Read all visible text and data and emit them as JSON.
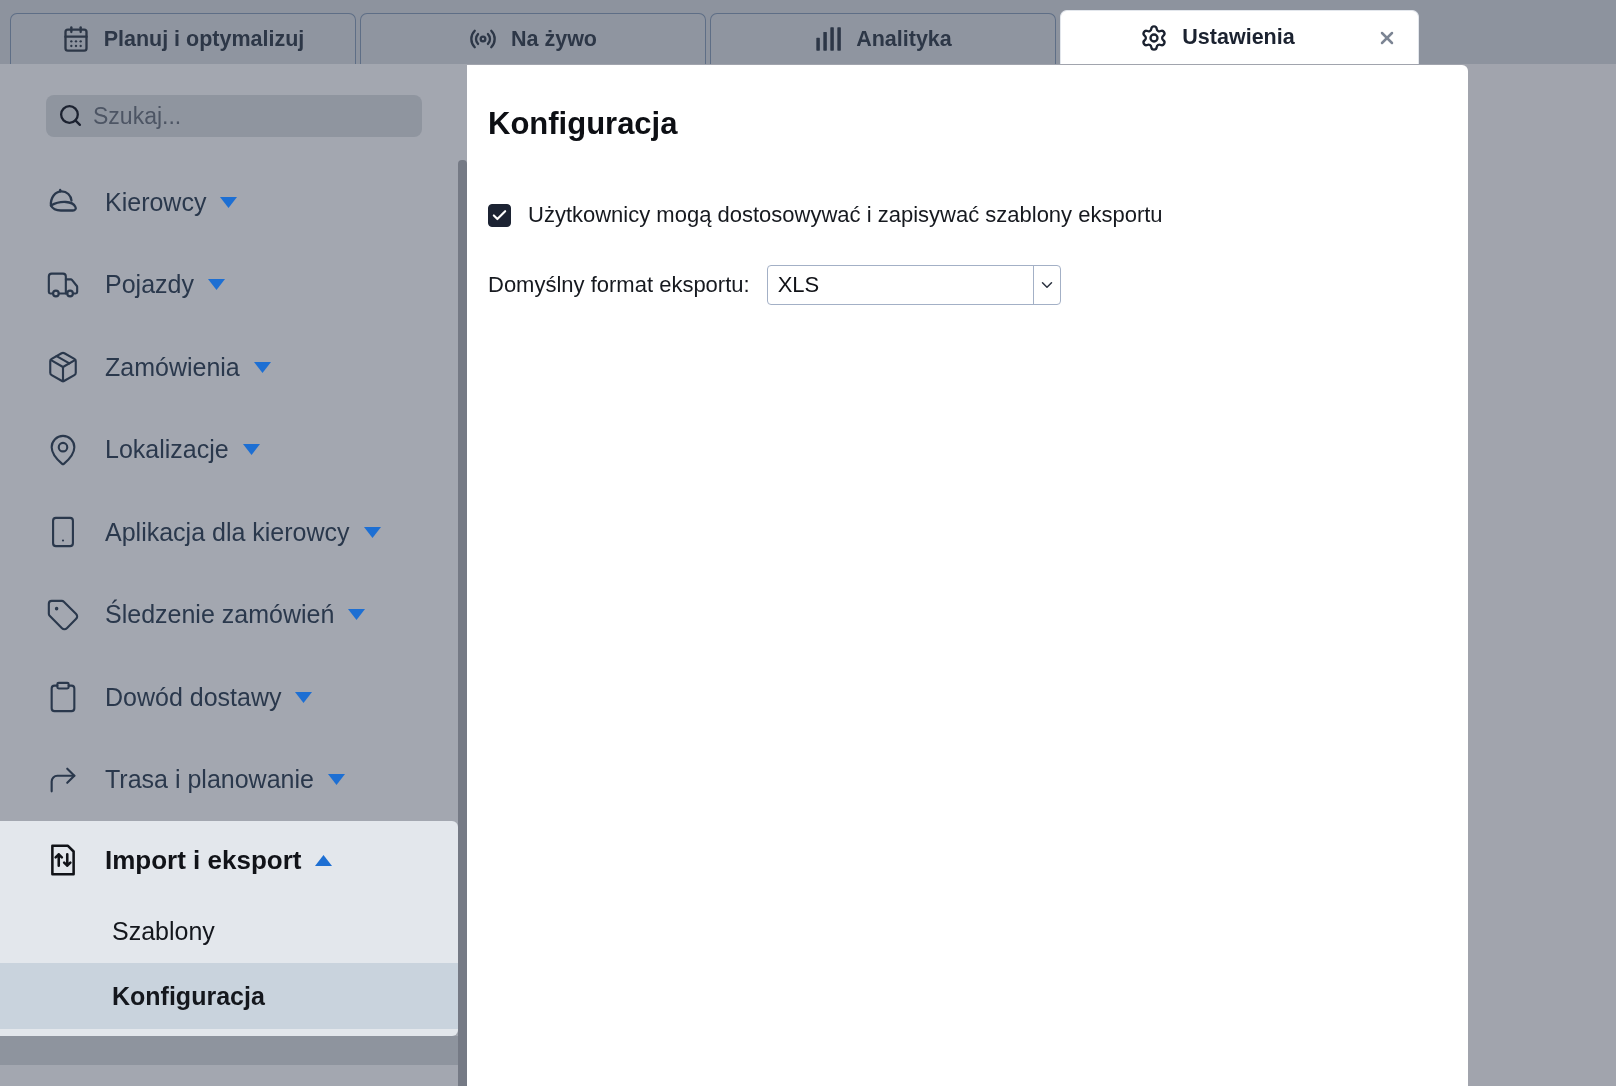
{
  "tabs": [
    {
      "label": "Planuj i optymalizuj",
      "selected": false,
      "closable": false
    },
    {
      "label": "Na żywo",
      "selected": false,
      "closable": false
    },
    {
      "label": "Analityka",
      "selected": false,
      "closable": false
    },
    {
      "label": "Ustawienia",
      "selected": true,
      "closable": true
    }
  ],
  "sidebar": {
    "search": {
      "placeholder": "Szukaj..."
    },
    "items": [
      {
        "label": "Kierowcy",
        "expanded": false
      },
      {
        "label": "Pojazdy",
        "expanded": false
      },
      {
        "label": "Zamówienia",
        "expanded": false
      },
      {
        "label": "Lokalizacje",
        "expanded": false
      },
      {
        "label": "Aplikacja dla kierowcy",
        "expanded": false
      },
      {
        "label": "Śledzenie zamówień",
        "expanded": false
      },
      {
        "label": "Dowód dostawy",
        "expanded": false
      },
      {
        "label": "Trasa i planowanie",
        "expanded": false
      },
      {
        "label": "Import i eksport",
        "expanded": true,
        "children": [
          {
            "label": "Szablony",
            "selected": false
          },
          {
            "label": "Konfiguracja",
            "selected": true
          }
        ]
      }
    ]
  },
  "content": {
    "title": "Konfiguracja",
    "options": [
      {
        "kind": "checkbox",
        "label": "Użytkownicy mogą dostosowywać i zapisywać szablony eksportu",
        "checked": true
      },
      {
        "kind": "select",
        "label": "Domyślny format eksportu:",
        "value": "XLS"
      }
    ]
  }
}
